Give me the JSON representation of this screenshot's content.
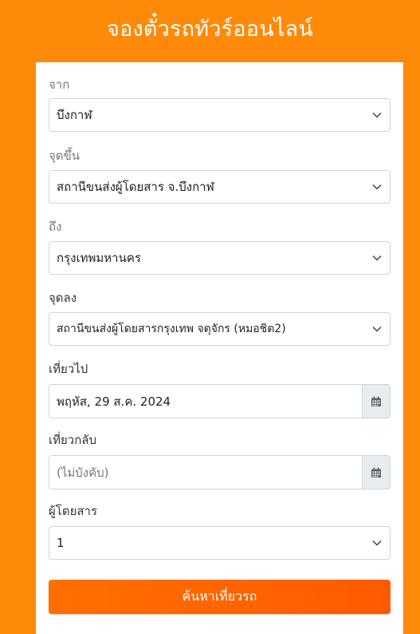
{
  "page": {
    "title": "จองตั๋วรถทัวร์ออนไลน์"
  },
  "form": {
    "from": {
      "label": "จาก",
      "value": "บึงกาฬ"
    },
    "pickup": {
      "label": "จุดขึ้น",
      "value": "สถานีขนส่งผู้โดยสาร จ.บึงกาฬ"
    },
    "to": {
      "label": "ถึง",
      "value": "กรุงเทพมหานคร"
    },
    "dropoff": {
      "label": "จุดลง",
      "value": "สถานีขนส่งผู้โดยสารกรุงเทพ จตุจักร (หมอชิต2)"
    },
    "depart": {
      "label": "เที่ยวไป",
      "value": "พฤหัส, 29 ส.ค. 2024"
    },
    "return": {
      "label": "เที่ยวกลับ",
      "placeholder": "(ไม่บังคับ)"
    },
    "passengers": {
      "label": "ผู้โดยสาร",
      "value": "1"
    },
    "submit_label": "ค้นหาเที่ยวรถ"
  },
  "colors": {
    "background": "#ff8a0a",
    "button": "#ff6200",
    "addon": "#e9ecef"
  },
  "icons": {
    "select_arrow": "chevron-down-icon",
    "date_addon": "calendar-icon"
  }
}
